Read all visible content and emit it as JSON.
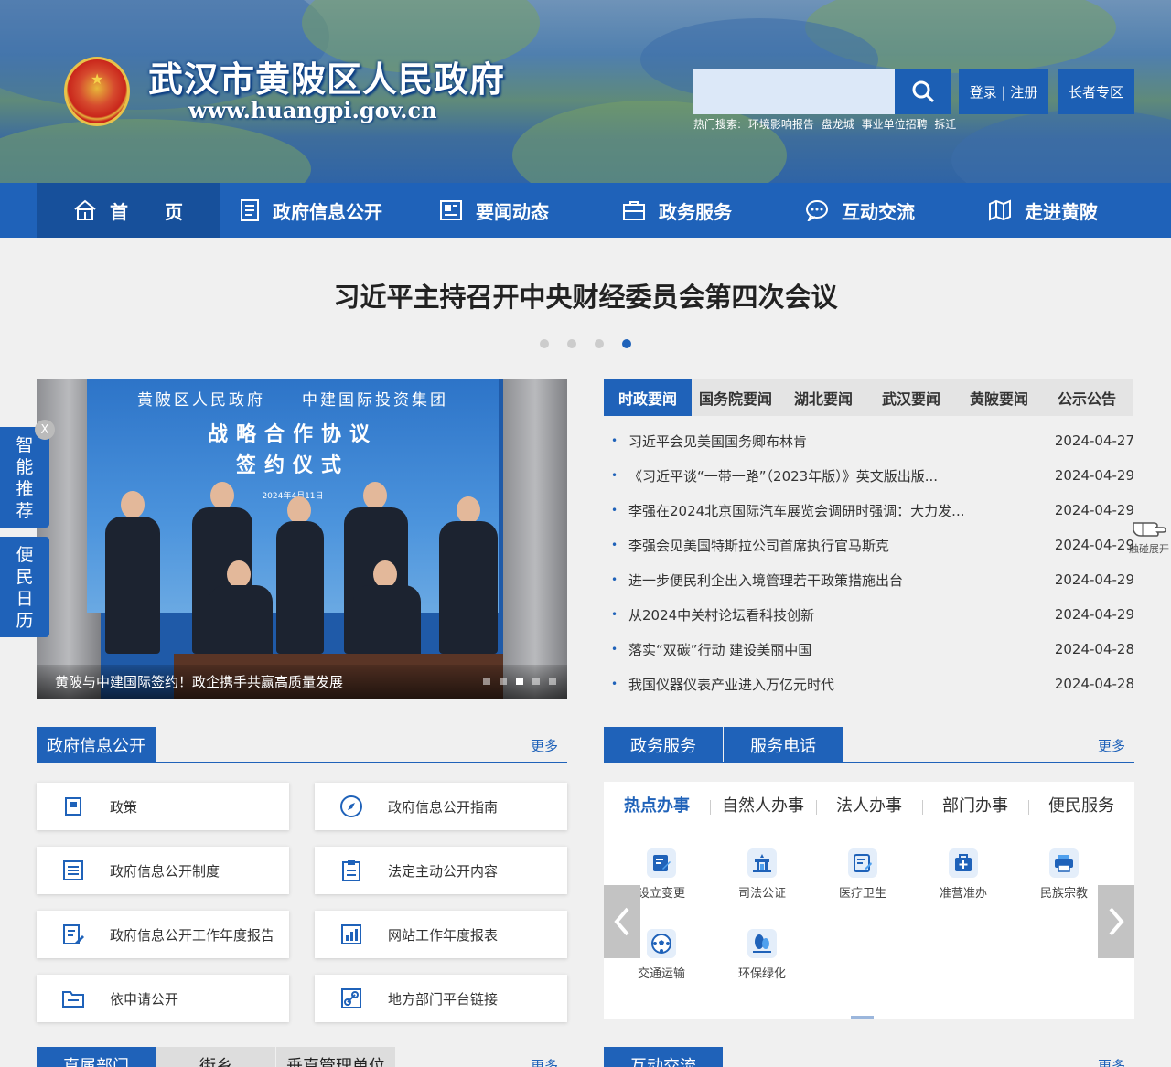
{
  "header": {
    "title": "武汉市黄陂区人民政府",
    "url": "www.huangpi.gov.cn",
    "search_placeholder": "",
    "login_label": "登录 | 注册",
    "elder_label": "长者专区",
    "hot_search_label": "热门搜索:",
    "hot_search_items": [
      "环境影响报告",
      "盘龙城",
      "事业单位招聘",
      "拆迁"
    ]
  },
  "nav": {
    "items": [
      {
        "label": "首　　页",
        "icon": "home-icon"
      },
      {
        "label": "政府信息公开",
        "icon": "document-icon"
      },
      {
        "label": "要闻动态",
        "icon": "news-icon"
      },
      {
        "label": "政务服务",
        "icon": "briefcase-icon"
      },
      {
        "label": "互动交流",
        "icon": "chat-icon"
      },
      {
        "label": "走进黄陂",
        "icon": "map-icon"
      }
    ]
  },
  "headline": "习近平主持召开中央财经委员会第四次会议",
  "carousel": {
    "active_index": 3,
    "count": 4
  },
  "slide": {
    "sign_line1": "黄陂区人民政府　　中建国际投资集团",
    "sign_line2": "战略合作协议",
    "sign_line3": "签约仪式",
    "sign_date": "2024年4月11日",
    "caption": "黄陂与中建国际签约！政企携手共赢高质量发展",
    "dot_count": 5,
    "active_dot": 2
  },
  "side_float": {
    "close_label": "X",
    "smart_label": "智能推荐",
    "calendar_label": "便民日历",
    "touch_label": "触碰展开"
  },
  "news": {
    "tabs": [
      "时政要闻",
      "国务院要闻",
      "湖北要闻",
      "武汉要闻",
      "黄陂要闻",
      "公示公告"
    ],
    "active_tab": 0,
    "items": [
      {
        "title": "习近平会见美国国务卿布林肯",
        "date": "2024-04-27"
      },
      {
        "title": "《习近平谈“一带一路”（2023年版）》英文版出版...",
        "date": "2024-04-29"
      },
      {
        "title": "李强在2024北京国际汽车展览会调研时强调：大力发...",
        "date": "2024-04-29"
      },
      {
        "title": "李强会见美国特斯拉公司首席执行官马斯克",
        "date": "2024-04-29"
      },
      {
        "title": "进一步便民利企出入境管理若干政策措施出台",
        "date": "2024-04-29"
      },
      {
        "title": "从2024中关村论坛看科技创新",
        "date": "2024-04-29"
      },
      {
        "title": "落实“双碳”行动 建设美丽中国",
        "date": "2024-04-28"
      },
      {
        "title": "我国仪器仪表产业进入万亿元时代",
        "date": "2024-04-28"
      }
    ]
  },
  "gov_info": {
    "title": "政府信息公开",
    "more": "更多",
    "cards": [
      {
        "label": "政策",
        "icon": "policy-icon"
      },
      {
        "label": "政府信息公开指南",
        "icon": "compass-icon"
      },
      {
        "label": "政府信息公开制度",
        "icon": "list-icon"
      },
      {
        "label": "法定主动公开内容",
        "icon": "clipboard-icon"
      },
      {
        "label": "政府信息公开工作年度报告",
        "icon": "report-icon"
      },
      {
        "label": "网站工作年度报表",
        "icon": "chart-icon"
      },
      {
        "label": "依申请公开",
        "icon": "folder-icon"
      },
      {
        "label": "地方部门平台链接",
        "icon": "link-icon"
      }
    ]
  },
  "services": {
    "tab1": "政务服务",
    "tab2": "服务电话",
    "more": "更多",
    "sub_tabs": [
      "热点办事",
      "自然人办事",
      "法人办事",
      "部门办事",
      "便民服务"
    ],
    "active_sub_tab": 0,
    "items": [
      {
        "label": "设立变更",
        "icon": "edit-icon"
      },
      {
        "label": "司法公证",
        "icon": "court-icon"
      },
      {
        "label": "医疗卫生",
        "icon": "medical-icon"
      },
      {
        "label": "准营准办",
        "icon": "first-aid-icon"
      },
      {
        "label": "民族宗教",
        "icon": "printer-icon"
      },
      {
        "label": "交通运输",
        "icon": "ball-icon"
      },
      {
        "label": "环保绿化",
        "icon": "tree-icon"
      }
    ]
  },
  "bottom": {
    "left_tabs": [
      "直属部门",
      "街乡",
      "垂直管理单位"
    ],
    "left_more": "更多",
    "right_title": "互动交流",
    "right_more": "更多"
  },
  "colors": {
    "primary": "#1f62b9",
    "nav_active": "#17509b",
    "tab_grey": "#e4e4e4"
  }
}
